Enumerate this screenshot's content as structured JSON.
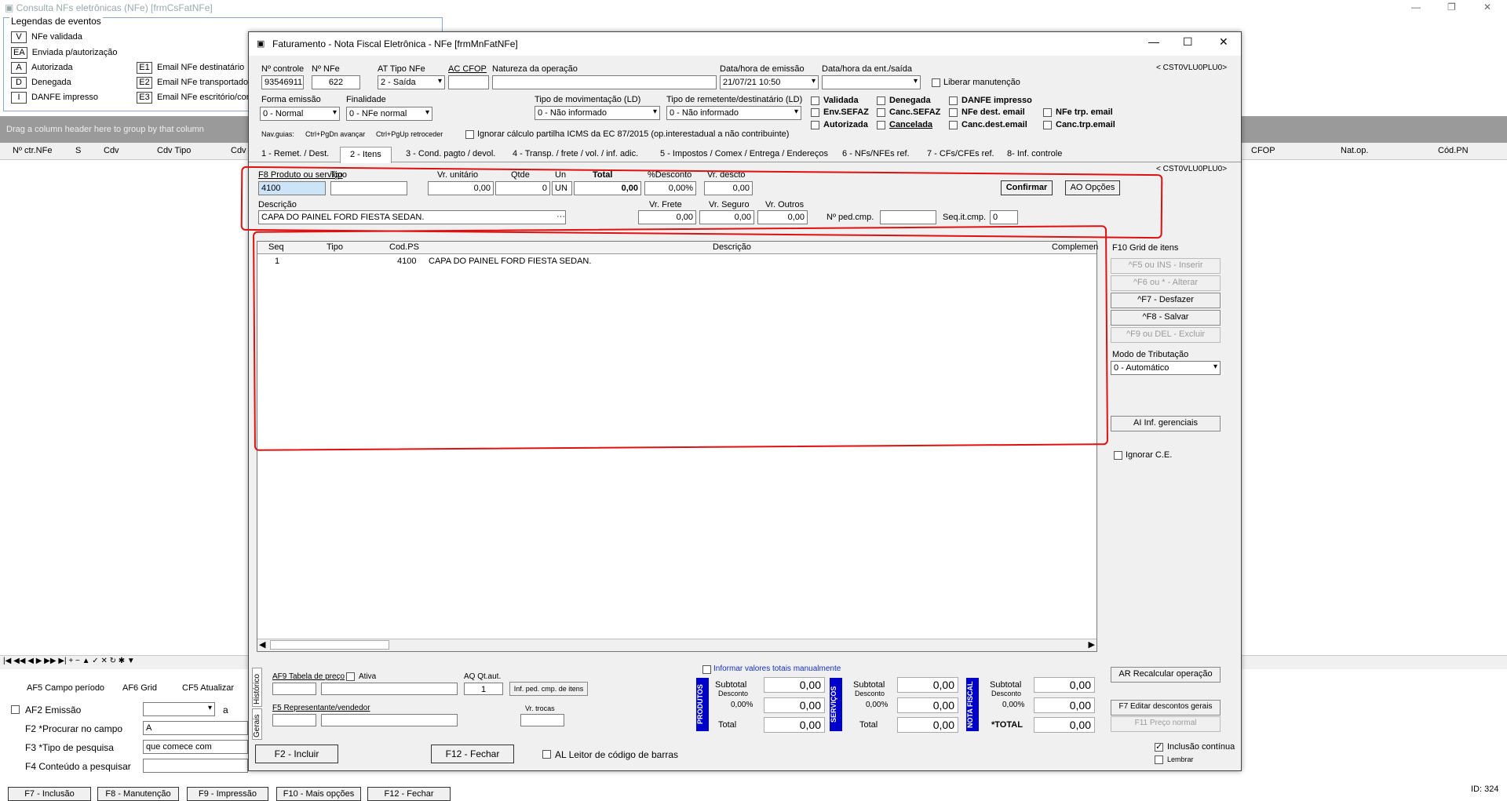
{
  "bg": {
    "title": "Consulta NFs eletrônicas (NFe) [frmCsFatNFe]",
    "legend_title": "Legendas de eventos",
    "legend": [
      {
        "key": "V",
        "label": "NFe validada"
      },
      {
        "key": "EA",
        "label": "Enviada p/autorização"
      },
      {
        "key": "A",
        "label": "Autorizada"
      },
      {
        "key": "D",
        "label": "Denegada"
      },
      {
        "key": "I",
        "label": "DANFE impresso"
      }
    ],
    "legend2": [
      {
        "key": "E1",
        "label": "Email NFe destinatário"
      },
      {
        "key": "E2",
        "label": "Email NFe transportador"
      },
      {
        "key": "E3",
        "label": "Email NFe escritório/con"
      }
    ],
    "group_hint": "Drag a column header here to group by that column",
    "columns": [
      "Nº ctr.NFe",
      "S",
      "Cdv",
      "Cdv Tipo",
      "Cdv"
    ],
    "columns_right": [
      "CFOP",
      "Nat.op.",
      "Cód.PN"
    ],
    "bottom": {
      "campo_periodo": "AF5 Campo período",
      "grid": "AF6 Grid",
      "atualizar": "CF5 Atualizar",
      "emissao": "AF2 Emissão",
      "a": "a",
      "procurar": "F2 *Procurar no campo",
      "procurar_val": "A",
      "tipo": "F3 *Tipo de pesquisa",
      "tipo_val": "que comece com",
      "conteudo": "F4 Conteúdo a pesquisar"
    },
    "footer_buttons": [
      "F7 - Inclusão",
      "F8 - Manutenção",
      "F9 - Impressão",
      "F10 - Mais opções",
      "F12 - Fechar"
    ],
    "id": "ID: 324"
  },
  "win": {
    "title": "Faturamento - Nota Fiscal Eletrônica - NFe [frmMnFatNFe]",
    "code": "< CST0VLU0PLU0>",
    "code2": "< CST0VLU0PLU0>",
    "h": {
      "nctrl_l": "Nº controle",
      "nctrl": "93546911",
      "nnfe_l": "Nº NFe",
      "nnfe": "622",
      "tipo_l": "AT Tipo NFe",
      "tipo": "2 - Saída",
      "cfop_l": "AC CFOP",
      "cfop": "",
      "nat_l": "Natureza da operação",
      "nat": "",
      "dtemi_l": "Data/hora de emissão",
      "dtemi": "21/07/21 10:50",
      "dtent_l": "Data/hora da ent./saída",
      "dtent": "",
      "liberar": "Liberar manutenção",
      "forma_l": "Forma emissão",
      "forma": "0 - Normal",
      "final_l": "Finalidade",
      "final": "0 - NFe normal",
      "tmov_l": "Tipo de movimentação (LD)",
      "tmov": "0 - Não informado",
      "trem_l": "Tipo de remetente/destinatário (LD)",
      "trem": "0 - Não informado",
      "st": [
        "Validada",
        "Env.SEFAZ",
        "Autorizada",
        "Denegada",
        "Canc.SEFAZ",
        "Cancelada",
        "DANFE impresso",
        "NFe dest. email",
        "Canc.dest.email",
        "NFe trp. email",
        "Canc.trp.email"
      ],
      "navguias": "Nav.guias:",
      "nav1": "Ctrl+PgDn avançar",
      "nav2": "Ctrl+PgUp retroceder",
      "ignorar": "Ignorar cálculo partilha ICMS da EC 87/2015 (op.interestadual a não contribuinte)"
    },
    "tabs": [
      "1 - Remet. / Dest.",
      "2 - Itens",
      "3 - Cond. pagto / devol.",
      "4 - Transp. / frete / vol. / inf. adic.",
      "5 - Impostos / Comex / Entrega / Endereços",
      "6 - NFs/NFEs ref.",
      "7 - CFs/CFEs ref.",
      "8- Inf. controle"
    ],
    "item": {
      "prod_l": "F8 Produto ou serviço",
      "prod": "4100",
      "tipo_l": "Tipo",
      "vunit_l": "Vr. unitário",
      "vunit": "0,00",
      "qtde_l": "Qtde",
      "qtde": "0",
      "un_l": "Un",
      "un": "UN",
      "total_l": "Total",
      "total": "0,00",
      "pdesc_l": "%Desconto",
      "pdesc": "0,00%",
      "vdesc_l": "Vr. descto",
      "vdesc": "0,00",
      "confirmar": "Confirmar",
      "opcoes": "AO Opções",
      "desc_l": "Descrição",
      "desc": "CAPA DO PAINEL FORD FIESTA SEDAN.",
      "frete_l": "Vr. Frete",
      "frete": "0,00",
      "seguro_l": "Vr. Seguro",
      "seguro": "0,00",
      "outros_l": "Vr. Outros",
      "outros": "0,00",
      "nped_l": "Nº ped.cmp.",
      "seq_l": "Seq.it.cmp.",
      "seq": "0"
    },
    "grid": {
      "cols": [
        "Seq",
        "Tipo",
        "Cod.PS",
        "Descrição",
        "Complemen"
      ],
      "rows": [
        {
          "seq": "1",
          "tipo": "",
          "cod": "4100",
          "desc": "CAPA DO PAINEL FORD FIESTA SEDAN."
        }
      ]
    },
    "side": {
      "grid_l": "F10 Grid de itens",
      "inserir": "^F5 ou INS - Inserir",
      "alterar": "^F6 ou * - Alterar",
      "desfazer": "^F7 - Desfazer",
      "salvar": "^F8 - Salvar",
      "excluir": "^F9 ou DEL - Excluir",
      "modo_l": "Modo de Tributação",
      "modo": "0 - Automático",
      "gerenciais": "AI Inf. gerenciais",
      "ignorar_ce": "Ignorar C.E.",
      "recalc": "AR Recalcular operação",
      "editar_desc": "F7 Editar descontos gerais",
      "preco": "F11 Preço normal",
      "inclusao": "Inclusão contínua",
      "lembrar": "Lembrar"
    },
    "bottom": {
      "vtab1": "Histórico",
      "vtab2": "Gerais",
      "tabela": "AF9 Tabela de preço",
      "ativa": "Ativa",
      "qtaut_l": "AQ Qt.aut.",
      "qtaut": "1",
      "infped": "Inf. ped. cmp. de itens",
      "repres": "F5 Representante/vendedor",
      "trocas_l": "Vr. trocas",
      "informar": "Informar valores totais manualmente",
      "incluir": "F2 - Incluir",
      "fechar": "F12 - Fechar",
      "leitor": "AL Leitor de código de barras"
    },
    "sums": [
      {
        "tag": "PRODUTOS",
        "subtotal_l": "Subtotal",
        "desconto_l": "Desconto",
        "total_l": "Total",
        "subtotal": "0,00",
        "pct": "0,00%",
        "desconto": "0,00",
        "total": "0,00"
      },
      {
        "tag": "SERVIÇOS",
        "subtotal_l": "Subtotal",
        "desconto_l": "Desconto",
        "total_l": "Total",
        "subtotal": "0,00",
        "pct": "0,00%",
        "desconto": "0,00",
        "total": "0,00"
      },
      {
        "tag": "NOTA FISCAL",
        "subtotal_l": "Subtotal",
        "desconto_l": "Desconto",
        "total_l": "*TOTAL",
        "subtotal": "0,00",
        "pct": "0,00%",
        "desconto": "0,00",
        "total": "0,00"
      }
    ]
  }
}
